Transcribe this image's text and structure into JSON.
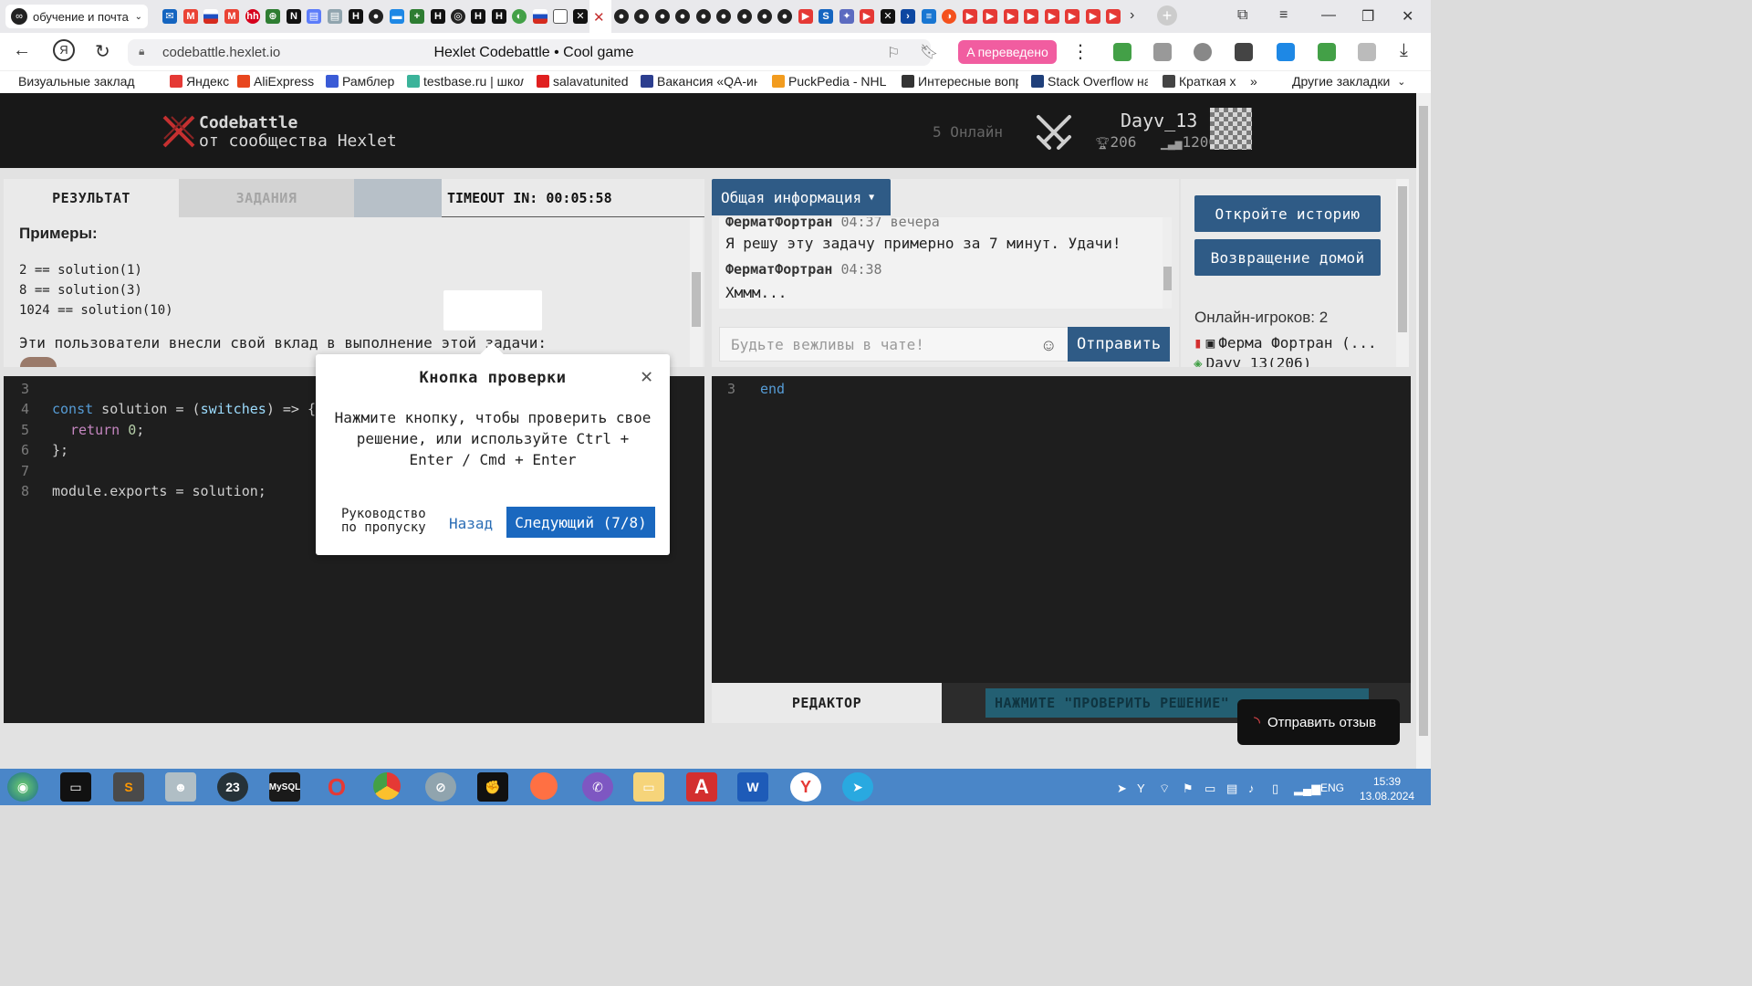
{
  "browser": {
    "tab_group_label": "обучение и почта",
    "url": "codebattle.hexlet.io",
    "page_title": "Hexlet Codebattle • Cool game",
    "translated_badge": "переведено",
    "bookmarks": [
      {
        "label": "Визуальные заклад",
        "color": "#ffffff"
      },
      {
        "label": "Яндекс",
        "color": "#e53935"
      },
      {
        "label": "AliExpress",
        "color": "#e8461e"
      },
      {
        "label": "Рамблер",
        "color": "#3a5bd6"
      },
      {
        "label": "testbase.ru | школ",
        "color": "#3bb39a"
      },
      {
        "label": "salavatunited",
        "color": "#e02020"
      },
      {
        "label": "Вакансия «QA-ин",
        "color": "#2c3e8f"
      },
      {
        "label": "PuckPedia - NHL S",
        "color": "#f29c1f"
      },
      {
        "label": "Интересные вопр",
        "color": "#333333"
      },
      {
        "label": "Stack Overflow на",
        "color": "#1f3f7a"
      },
      {
        "label": "Краткая х",
        "color": "#444444"
      }
    ],
    "bookmarks_more": "»",
    "other_bookmarks": "Другие закладки"
  },
  "header": {
    "logo_title": "Codebattle",
    "logo_subtitle": "от сообщества Hexlet",
    "online_count": "5 Онлайн",
    "username": "Dayv_13",
    "rating": "206",
    "rating2": "1200",
    "colors": {
      "bg": "#181818",
      "accent": "#c53030"
    }
  },
  "left_panel": {
    "tab_result": "РЕЗУЛЬТАТ",
    "tab_tasks": "ЗАДАНИЯ",
    "timeout": "TIMEOUT IN: 00:05:58",
    "examples_heading": "Примеры:",
    "examples": [
      "2  == solution(1)",
      "8  == solution(3)",
      "1024  == solution(10)"
    ],
    "contributors_text": "Эти пользователи внесли свой вклад в выполнение этой задачи:"
  },
  "left_editor": {
    "line_numbers": [
      "3",
      "4",
      "5",
      "6",
      "7",
      "8"
    ],
    "line4": {
      "kw": "const",
      "name": " solution = (",
      "param": "switches",
      "rest": ") => {"
    },
    "line5": {
      "kw": "return",
      "num": "0",
      "rest": ";"
    },
    "line6": "};",
    "line8": "module.exports = solution;"
  },
  "right_info": {
    "dropdown_label": "Общая информация",
    "chat": [
      {
        "name": "ФерматФортран",
        "time": "04:37 вечера",
        "text": "Я решу эту задачу примерно за 7 минут. Удачи!"
      },
      {
        "name": "ФерматФортран",
        "time": "04:38",
        "text": "Хммм..."
      }
    ],
    "chat_placeholder": "Будьте вежливы в чате!",
    "send_label": "Отправить"
  },
  "sidebar": {
    "open_history": "Откройте историю",
    "go_home": "Возвращение домой",
    "online_players_label": "Онлайн-игроков:",
    "online_players_count": "2",
    "players": [
      "Ферма Фортран (...",
      "Dayv_13(206)"
    ]
  },
  "right_editor": {
    "line_number": "3",
    "code": "end",
    "tab_editor": "РЕДАКТОР",
    "press_check": "НАЖМИТЕ \"ПРОВЕРИТЬ РЕШЕНИЕ\""
  },
  "tour": {
    "title": "Кнопка проверки",
    "body": "Нажмите кнопку, чтобы проверить свое решение, или используйте Ctrl + Enter / Cmd + Enter",
    "skip": "Руководство по пропуску",
    "back": "Назад",
    "next": "Следующий (7/8)"
  },
  "feedback_label": "Отправить отзыв",
  "taskbar": {
    "lang": "ENG",
    "time": "15:39",
    "date": "13.08.2024"
  }
}
